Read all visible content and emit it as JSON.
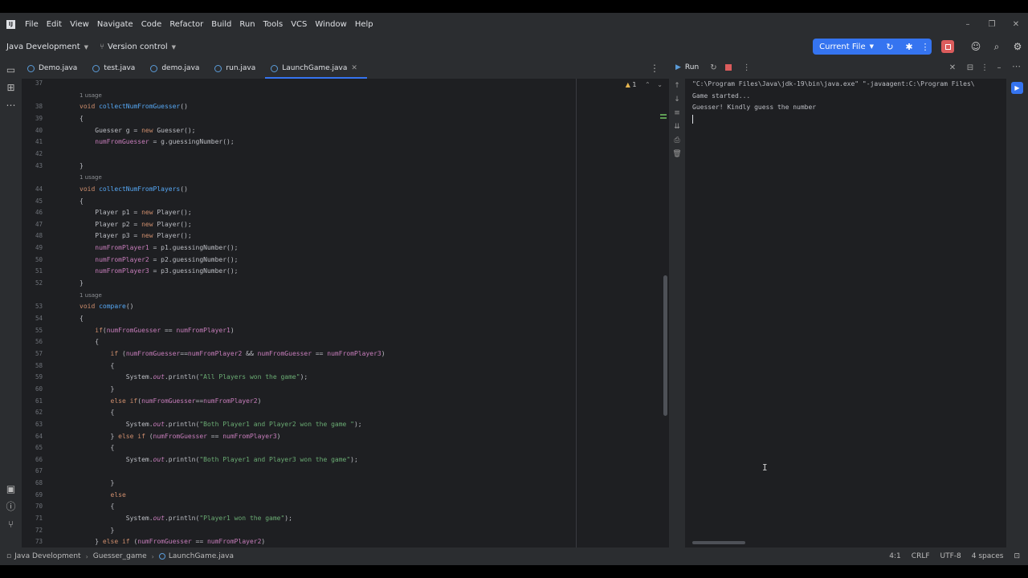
{
  "menubar": {
    "logo": "IJ",
    "items": [
      "File",
      "Edit",
      "View",
      "Navigate",
      "Code",
      "Refactor",
      "Build",
      "Run",
      "Tools",
      "VCS",
      "Window",
      "Help"
    ]
  },
  "toolbar": {
    "project": "Java Development",
    "version_control": "Version control",
    "run_config": "Current File"
  },
  "tabs": [
    {
      "label": "Demo.java",
      "active": false
    },
    {
      "label": "test.java",
      "active": false
    },
    {
      "label": "demo.java",
      "active": false
    },
    {
      "label": "run.java",
      "active": false
    },
    {
      "label": "LaunchGame.java",
      "active": true
    }
  ],
  "editor": {
    "warning_count": "1",
    "lines": [
      {
        "n": "37",
        "html": ""
      },
      {
        "n": "",
        "html": "<span class='usage'>1 usage</span>"
      },
      {
        "n": "38",
        "html": "<span class='kw'>void</span> <span class='fn'>collectNumFromGuesser</span>()"
      },
      {
        "n": "39",
        "html": "{"
      },
      {
        "n": "40",
        "html": "    Guesser g = <span class='kw'>new</span> Guesser();"
      },
      {
        "n": "41",
        "html": "    <span class='fld'>numFromGuesser</span> = g.guessingNumber();"
      },
      {
        "n": "42",
        "html": ""
      },
      {
        "n": "43",
        "html": "}"
      },
      {
        "n": "",
        "html": "<span class='usage'>1 usage</span>"
      },
      {
        "n": "44",
        "html": "<span class='kw'>void</span> <span class='fn'>collectNumFromPlayers</span>()"
      },
      {
        "n": "45",
        "html": "{"
      },
      {
        "n": "46",
        "html": "    Player p1 = <span class='kw'>new</span> Player();"
      },
      {
        "n": "47",
        "html": "    Player p2 = <span class='kw'>new</span> Player();"
      },
      {
        "n": "48",
        "html": "    Player p3 = <span class='kw'>new</span> Player();"
      },
      {
        "n": "49",
        "html": "    <span class='fld'>numFromPlayer1</span> = p1.guessingNumber();"
      },
      {
        "n": "50",
        "html": "    <span class='fld'>numFromPlayer2</span> = p2.guessingNumber();"
      },
      {
        "n": "51",
        "html": "    <span class='fld'>numFromPlayer3</span> = p3.guessingNumber();"
      },
      {
        "n": "52",
        "html": "}"
      },
      {
        "n": "",
        "html": "<span class='usage'>1 usage</span>"
      },
      {
        "n": "53",
        "html": "<span class='kw'>void</span> <span class='fn'>compare</span>()"
      },
      {
        "n": "54",
        "html": "{"
      },
      {
        "n": "55",
        "html": "    <span class='kw'>if</span>(<span class='fld'>numFromGuesser</span> == <span class='fld'>numFromPlayer1</span>)"
      },
      {
        "n": "56",
        "html": "    {"
      },
      {
        "n": "57",
        "html": "        <span class='kw'>if</span> (<span class='fld'>numFromGuesser</span>==<span class='fld'>numFromPlayer2</span> &amp;&amp; <span class='fld'>numFromGuesser</span> == <span class='fld'>numFromPlayer3</span>)"
      },
      {
        "n": "58",
        "html": "        {"
      },
      {
        "n": "59",
        "html": "            System.<span class='st'>out</span>.println(<span class='str'>\"All Players won the game\"</span>);"
      },
      {
        "n": "60",
        "html": "        }"
      },
      {
        "n": "61",
        "html": "        <span class='kw'>else if</span>(<span class='fld'>numFromGuesser</span>==<span class='fld'>numFromPlayer2</span>)"
      },
      {
        "n": "62",
        "html": "        {"
      },
      {
        "n": "63",
        "html": "            System.<span class='st'>out</span>.println(<span class='str'>\"Both Player1 and Player2 won the game \"</span>);"
      },
      {
        "n": "64",
        "html": "        } <span class='kw'>else if</span> (<span class='fld'>numFromGuesser</span> == <span class='fld'>numFromPlayer3</span>)"
      },
      {
        "n": "65",
        "html": "        {"
      },
      {
        "n": "66",
        "html": "            System.<span class='st'>out</span>.println(<span class='str'>\"Both Player1 and Player3 won the game\"</span>);"
      },
      {
        "n": "67",
        "html": ""
      },
      {
        "n": "68",
        "html": "        }"
      },
      {
        "n": "69",
        "html": "        <span class='kw'>else</span>"
      },
      {
        "n": "70",
        "html": "        {"
      },
      {
        "n": "71",
        "html": "            System.<span class='st'>out</span>.println(<span class='str'>\"Player1 won the game\"</span>);"
      },
      {
        "n": "72",
        "html": "        }"
      },
      {
        "n": "73",
        "html": "    } <span class='kw'>else if</span> (<span class='fld'>numFromGuesser</span> == <span class='fld'>numFromPlayer2</span>)"
      }
    ]
  },
  "run": {
    "tab_label": "Run",
    "output": [
      "\"C:\\Program Files\\Java\\jdk-19\\bin\\java.exe\" \"-javaagent:C:\\Program Files\\",
      "Game started...",
      "Guesser! Kindly guess the number"
    ]
  },
  "status": {
    "crumbs": [
      "Java Development",
      "Guesser_game",
      "LaunchGame.java"
    ],
    "position": "4:1",
    "line_sep": "CRLF",
    "encoding": "UTF-8",
    "indent": "4 spaces"
  },
  "colors": {
    "accent": "#3574f0",
    "stop": "#db5c5c",
    "keyword": "#cf8e6d",
    "function": "#56a8f5",
    "field": "#c77dbb",
    "string": "#6aab73"
  }
}
